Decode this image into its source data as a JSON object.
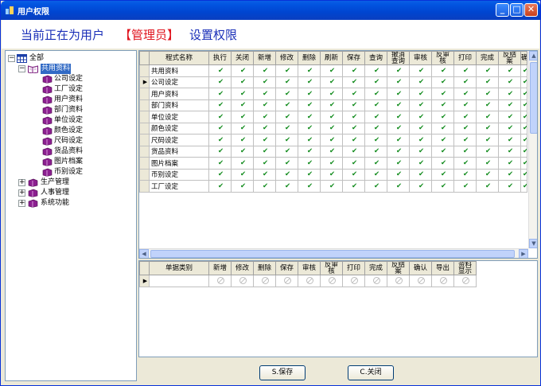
{
  "window": {
    "title": "用户权限",
    "minimize_glyph": "_",
    "maximize_glyph": "□",
    "close_glyph": "✕"
  },
  "header": {
    "prefix": "当前正在为用户",
    "user": "【管理员】",
    "suffix": "设置权限"
  },
  "tree": {
    "root": "全部",
    "groups": [
      {
        "label": "共用资料",
        "expanded": true,
        "selected": true,
        "children": [
          "公司设定",
          "工厂设定",
          "用户资料",
          "部门资料",
          "单位设定",
          "颜色设定",
          "尺码设定",
          "货品资料",
          "图片档案",
          "币别设定"
        ]
      },
      {
        "label": "生产管理",
        "expanded": false
      },
      {
        "label": "人事管理",
        "expanded": false
      },
      {
        "label": "系统功能",
        "expanded": false
      }
    ],
    "expand_glyph": "+",
    "collapse_glyph": "−"
  },
  "top_grid": {
    "columns": [
      "程式名称",
      "执行",
      "关闭",
      "新增",
      "修改",
      "删除",
      "刷新",
      "保存",
      "查询",
      "撤消\n查询",
      "审核",
      "反审\n核",
      "打印",
      "完成",
      "反结\n案",
      "确"
    ],
    "rows": [
      "共用资料",
      "公司设定",
      "用户资料",
      "部门资料",
      "单位设定",
      "颜色设定",
      "尺码设定",
      "货品资料",
      "图片档案",
      "币别设定",
      "工厂设定"
    ],
    "current_row": 1,
    "check_glyph": "✔",
    "current_row_glyph": "▶"
  },
  "bottom_grid": {
    "columns": [
      "单据类别",
      "新增",
      "修改",
      "删除",
      "保存",
      "审核",
      "反审\n核",
      "打印",
      "完成",
      "反结\n案",
      "确认",
      "导出",
      "资料\n显示"
    ],
    "current_row_glyph": "▶"
  },
  "scrollbar": {
    "up": "▲",
    "down": "▼",
    "left": "◀",
    "right": "▶"
  },
  "buttons": {
    "save": "S.保存",
    "close": "C.关闭"
  },
  "colors": {
    "header_blue": "#1a2fb8",
    "header_red": "#e0141e",
    "check_green": "#0f8a1a",
    "title_bar": "#0254e0",
    "selection": "#316ac5"
  }
}
